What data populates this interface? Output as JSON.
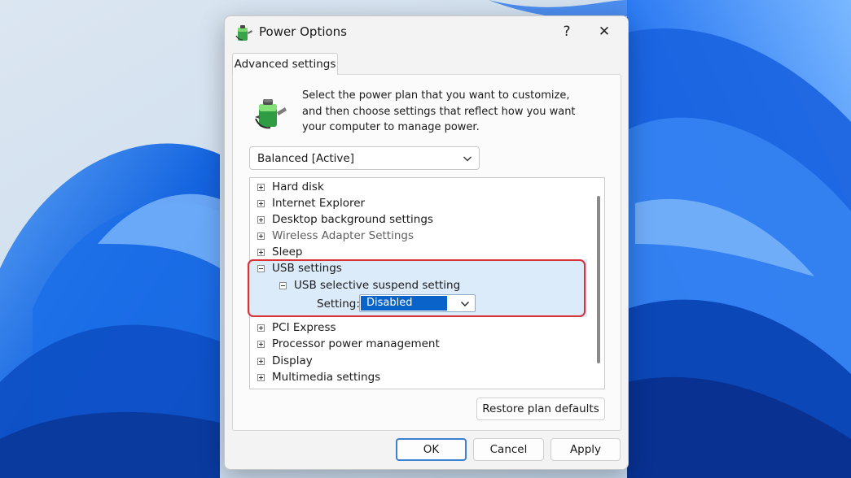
{
  "window": {
    "title": "Power Options",
    "help_glyph": "?",
    "close_glyph": "✕"
  },
  "tabs": [
    {
      "label": "Advanced settings",
      "selected": true
    }
  ],
  "intro_text": "Select the power plan that you want to customize, and then choose settings that reflect how you want your computer to manage power.",
  "plan_select": {
    "value": "Balanced [Active]"
  },
  "tree": {
    "items": [
      {
        "label": "Hard disk",
        "expanded": false
      },
      {
        "label": "Internet Explorer",
        "expanded": false
      },
      {
        "label": "Desktop background settings",
        "expanded": false
      },
      {
        "label": "Wireless Adapter Settings",
        "expanded": false
      },
      {
        "label": "Sleep",
        "expanded": false
      },
      {
        "label": "USB settings",
        "expanded": true
      },
      {
        "label": "USB selective suspend setting",
        "expanded": true
      },
      {
        "label": "PCI Express",
        "expanded": false
      },
      {
        "label": "Processor power management",
        "expanded": false
      },
      {
        "label": "Display",
        "expanded": false
      },
      {
        "label": "Multimedia settings",
        "expanded": false
      }
    ],
    "setting_label": "Setting:",
    "setting_value": "Disabled"
  },
  "buttons": {
    "restore": "Restore plan defaults",
    "ok": "OK",
    "cancel": "Cancel",
    "apply": "Apply"
  },
  "colors": {
    "highlight_frame": "#d9303a",
    "selected_value_bg": "#0a63c9",
    "usb_row_highlight": "#dcebfa"
  },
  "icons": {
    "app": "power-options-battery-icon",
    "plan": "battery-plug-icon"
  }
}
